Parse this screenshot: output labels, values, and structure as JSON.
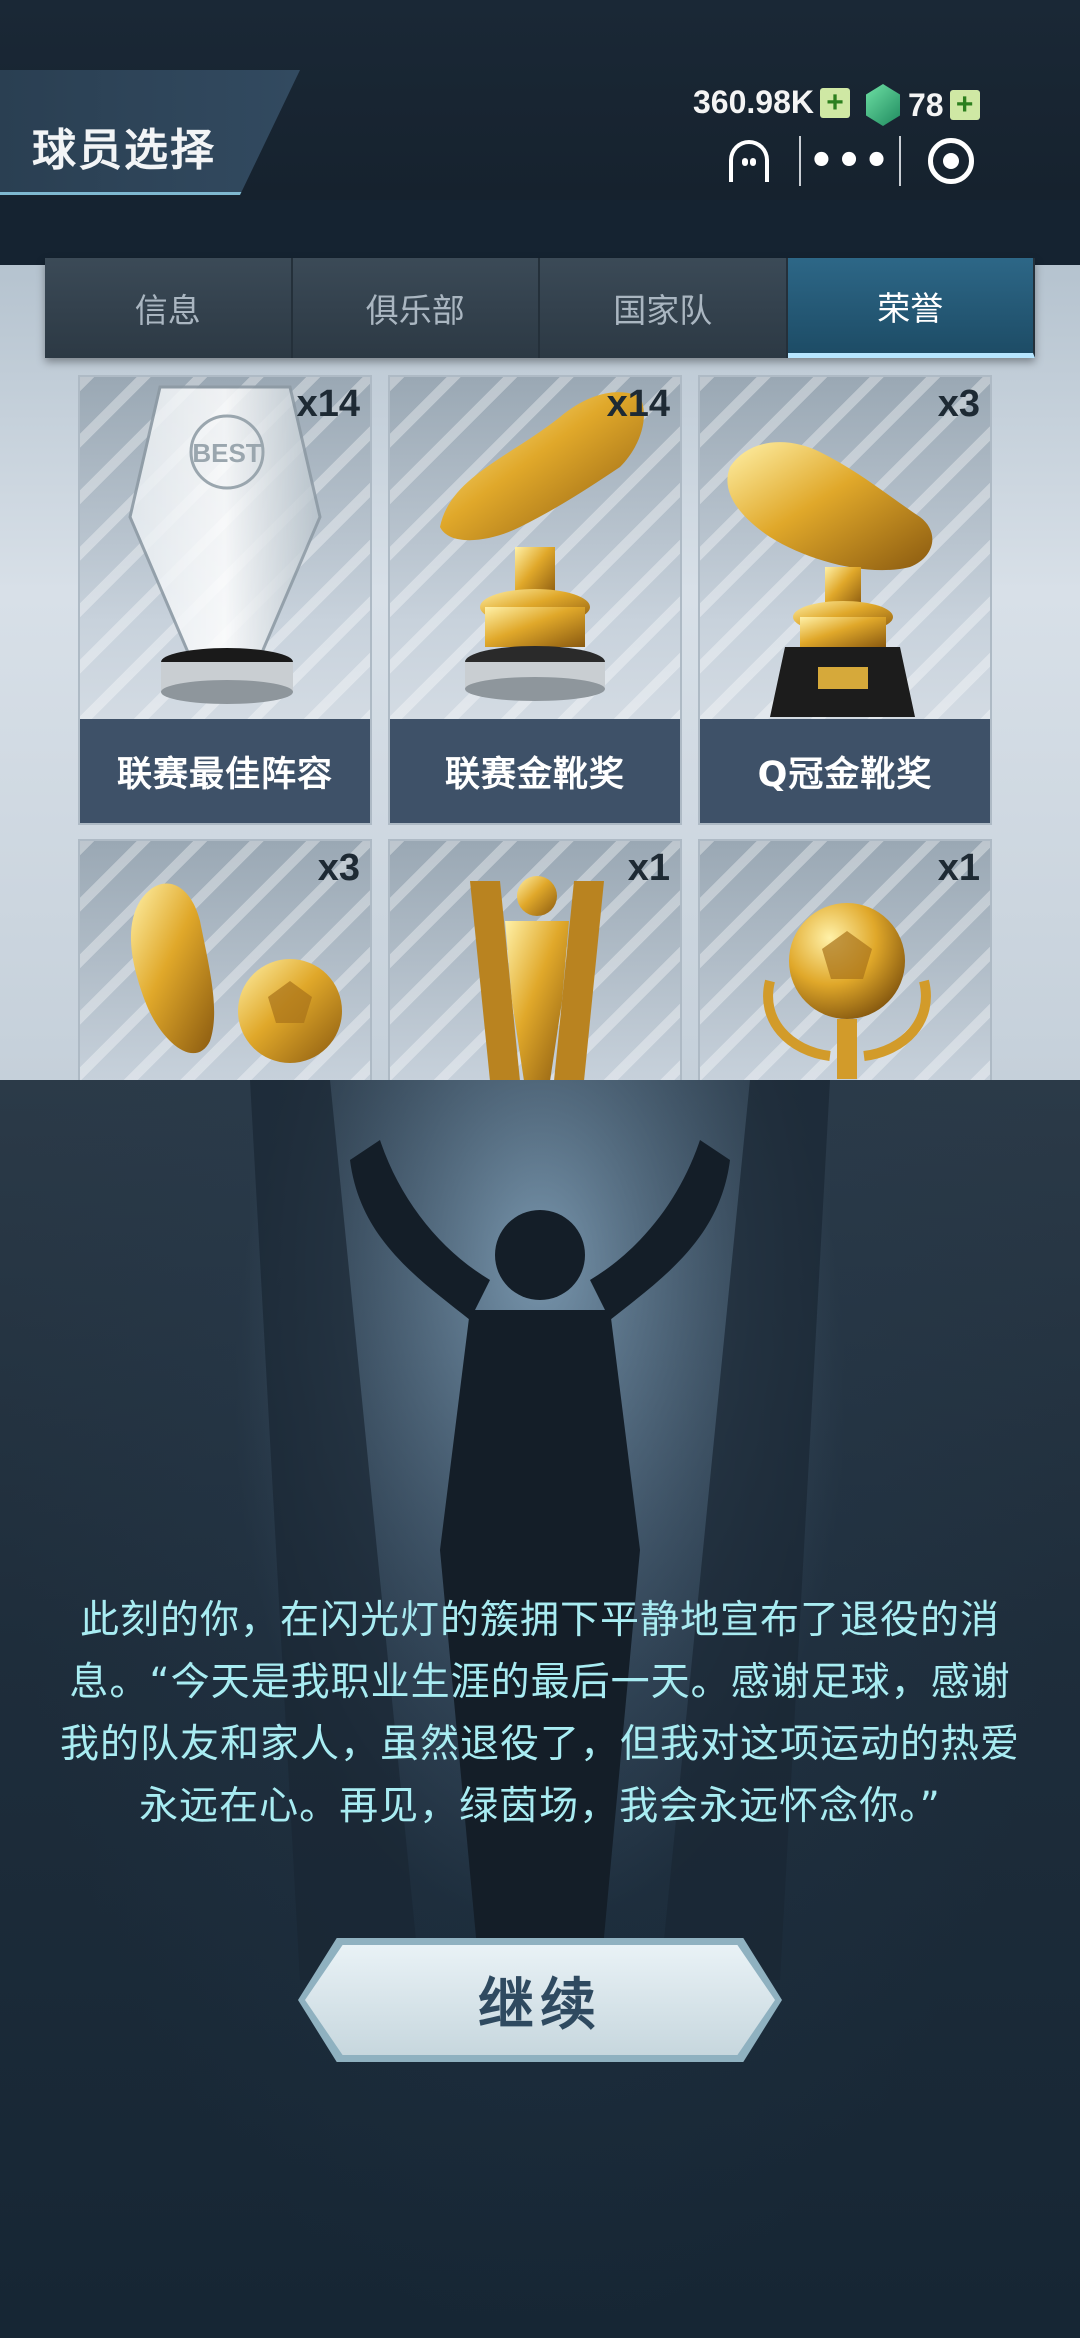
{
  "header": {
    "title": "球员选择",
    "coins": "360.98K",
    "gems": "78",
    "coins_plus": "+",
    "gems_plus": "+"
  },
  "capsule": {
    "more": "•••"
  },
  "tabs": [
    {
      "label": "信息"
    },
    {
      "label": "俱乐部"
    },
    {
      "label": "国家队"
    },
    {
      "label": "荣誉"
    }
  ],
  "active_tab": "荣誉",
  "honors": [
    {
      "name": "联赛最佳阵容",
      "count": "x14",
      "icon": "crystal-trophy-icon"
    },
    {
      "name": "联赛金靴奖",
      "count": "x14",
      "icon": "golden-boot-icon"
    },
    {
      "name": "Q冠金靴奖",
      "count": "x3",
      "icon": "golden-boot-stand-icon"
    },
    {
      "name": "",
      "count": "x3",
      "icon": "boot-and-ball-trophy-icon"
    },
    {
      "name": "",
      "count": "x1",
      "icon": "player-statue-trophy-icon"
    },
    {
      "name": "",
      "count": "x1",
      "icon": "golden-ball-trophy-icon"
    }
  ],
  "story": "此刻的你，在闪光灯的簇拥下平静地宣布了退役的消息。“今天是我职业生涯的最后一天。感谢足球，感谢我的队友和家人，虽然退役了，但我对这项运动的热爱永远在心。再见，绿茵场，我会永远怀念你。”",
  "continue_label": "继续",
  "colors": {
    "accent": "#a8ecf2",
    "tab_active": "#2d6787",
    "card_label_bg": "#3e5168"
  }
}
